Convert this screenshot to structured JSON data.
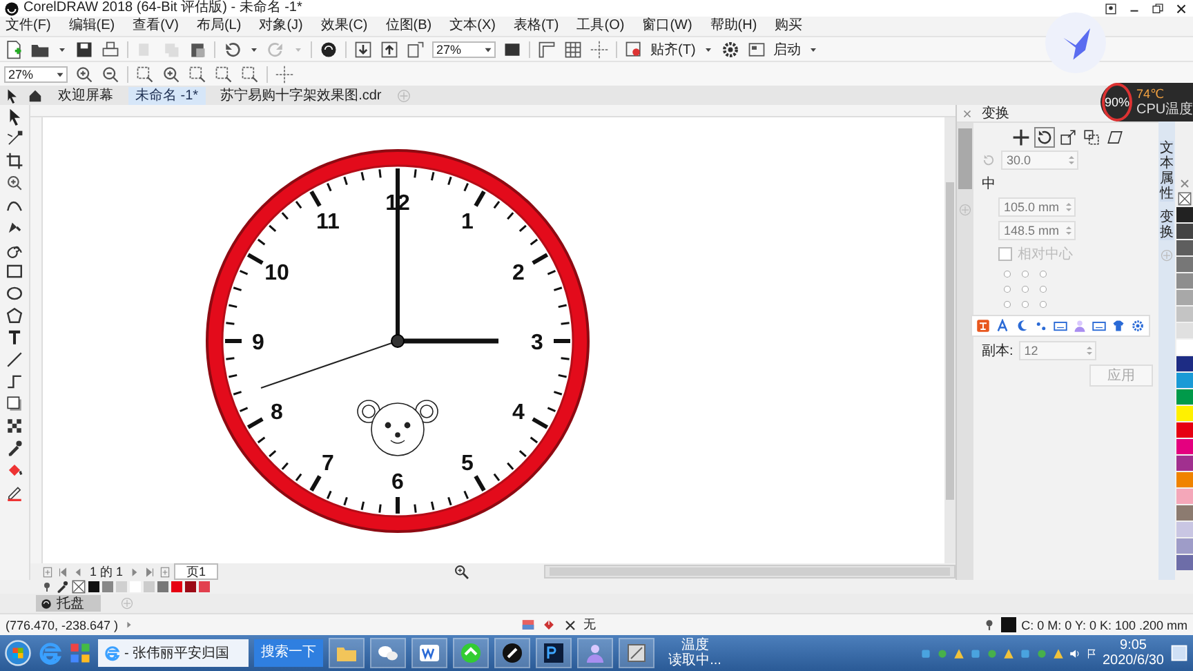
{
  "window": {
    "title": "CorelDRAW 2018 (64-Bit 评估版) - 未命名 -1*"
  },
  "menu": [
    "文件(F)",
    "编辑(E)",
    "查看(V)",
    "布局(L)",
    "对象(J)",
    "效果(C)",
    "位图(B)",
    "文本(X)",
    "表格(T)",
    "工具(O)",
    "窗口(W)",
    "帮助(H)",
    "购买"
  ],
  "toolbar": {
    "zoom": "27%",
    "snap": "贴齐(T)",
    "launch": "启动"
  },
  "property_bar": {
    "zoom": "27%"
  },
  "doc_tabs": [
    {
      "label": "欢迎屏幕",
      "selected": false
    },
    {
      "label": "未命名 -1*",
      "selected": true
    },
    {
      "label": "苏宁易购十字架效果图.cdr",
      "selected": false
    }
  ],
  "clock": {
    "numerals": [
      "12",
      "1",
      "2",
      "3",
      "4",
      "5",
      "6",
      "7",
      "8",
      "9",
      "10",
      "11"
    ]
  },
  "page_nav": {
    "counter": "1 的 1",
    "page_tab": "页1"
  },
  "docker": {
    "title": "变换",
    "angle": "30.0",
    "center_label": "中",
    "x": "105.0 mm",
    "y": "148.5 mm",
    "relative": "相对中心",
    "relative_checked": false,
    "copies_label": "副本:",
    "copies": "12",
    "apply": "应用"
  },
  "side_tabs": [
    "文本属性",
    "变换"
  ],
  "palette": [
    {
      "color": "#222222"
    },
    {
      "color": "#444444"
    },
    {
      "color": "#5e5e5e"
    },
    {
      "color": "#777777"
    },
    {
      "color": "#8e8e8e"
    },
    {
      "color": "#a8a8a8"
    },
    {
      "color": "#c4c4c4"
    },
    {
      "color": "#e0e0e0"
    },
    {
      "color": "#ffffff"
    },
    {
      "color": "#1d2c84"
    },
    {
      "color": "#1a9ad6"
    },
    {
      "color": "#009a4a"
    },
    {
      "color": "#fff100"
    },
    {
      "color": "#e60012"
    },
    {
      "color": "#e4007f"
    },
    {
      "color": "#a1308f"
    },
    {
      "color": "#f08300"
    },
    {
      "color": "#f4a7b9"
    },
    {
      "color": "#8c7b70"
    },
    {
      "color": "#c9c6e3"
    },
    {
      "color": "#9e9cc8"
    },
    {
      "color": "#6d6da8"
    }
  ],
  "document_palette": [
    {
      "color": "#111111"
    },
    {
      "color": "#888888"
    },
    {
      "color": "#d0d0d0"
    },
    {
      "color": "#ffffff"
    },
    {
      "color": "#cccccc"
    },
    {
      "color": "#777777"
    },
    {
      "color": "#e60012"
    },
    {
      "color": "#9c0a16"
    },
    {
      "color": "#e2404e"
    }
  ],
  "tray": {
    "label": "托盘"
  },
  "status_bar": {
    "coordinates": "(776.470, -238.647 )",
    "fill": "无",
    "outline": "C: 0 M: 0 Y: 0 K: 100  .200 mm"
  },
  "cpu_meter": {
    "usage": "90%",
    "temperature": "74℃",
    "label": "CPU温度"
  },
  "taskbar": {
    "window_button": "- 张伟丽平安归国",
    "search_button": "搜索一下",
    "weather": "温度",
    "weather_status": "读取中...",
    "time": "9:05",
    "date": "2020/6/30"
  }
}
